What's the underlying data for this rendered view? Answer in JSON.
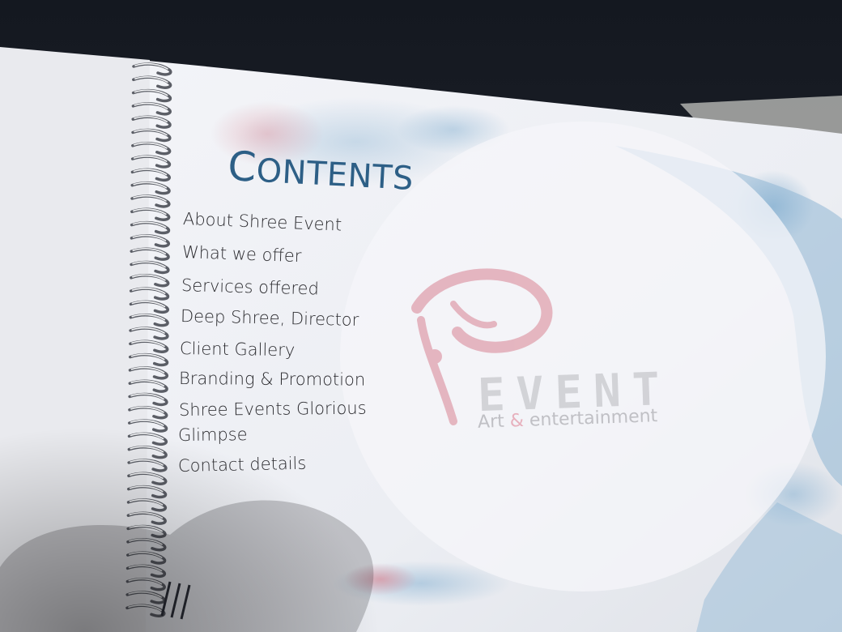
{
  "title": {
    "first": "C",
    "rest": "ONTENTS"
  },
  "contents": [
    "About Shree Event",
    "What we offer",
    "Services offered",
    "Deep Shree, Director",
    "Client Gallery",
    "Branding & Promotion",
    "Shree Events Glorious",
    "Glimpse",
    "Contact details"
  ],
  "logo": {
    "wordmark": "EVENT",
    "tagline_left": "Art",
    "tagline_amp": "&",
    "tagline_right": "entertainment"
  },
  "colors": {
    "title": "#2d5f86",
    "text": "#2b2b2f",
    "splash_blue": "#8fb6d4",
    "splash_pink": "#d98b98"
  }
}
